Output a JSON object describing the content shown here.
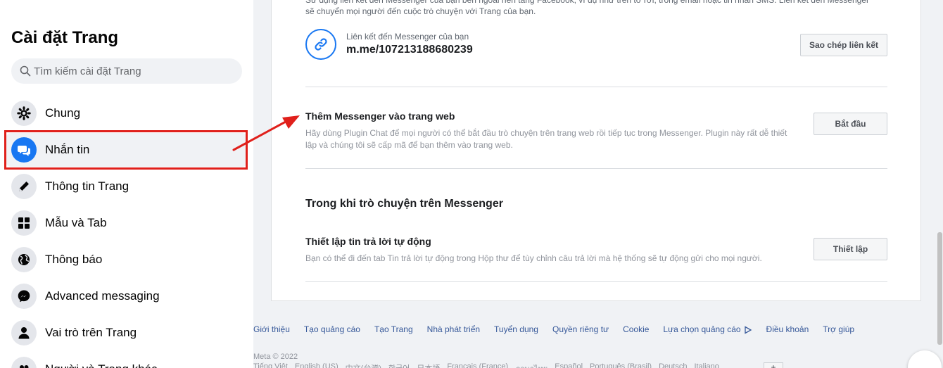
{
  "sidebar": {
    "title": "Cài đặt Trang",
    "search_placeholder": "Tìm kiếm cài đặt Trang",
    "items": [
      {
        "label": "Chung",
        "icon": "gear-icon"
      },
      {
        "label": "Nhắn tin",
        "icon": "chat-bubbles-icon",
        "active": true
      },
      {
        "label": "Thông tin Trang",
        "icon": "pencil-icon"
      },
      {
        "label": "Mẫu và Tab",
        "icon": "grid-icon"
      },
      {
        "label": "Thông báo",
        "icon": "globe-icon"
      },
      {
        "label": "Advanced messaging",
        "icon": "messenger-icon"
      },
      {
        "label": "Vai trò trên Trang",
        "icon": "person-icon"
      },
      {
        "label": "Người và Trang khác",
        "icon": "people-icon"
      }
    ]
  },
  "main": {
    "top_text_line1": "Sử dụng liên kết đến Messenger của bạn bên ngoài nền tảng Facebook, ví dụ như trên tờ rơi, trong email hoặc tin nhắn SMS. Liên kết đến Messenger",
    "top_text_line2": "sẽ chuyển mọi người đến cuộc trò chuyện với Trang của bạn.",
    "link_caption": "Liên kết đến Messenger của bạn",
    "link_value": "m.me/107213188680239",
    "copy_button": "Sao chép liên kết",
    "web_section": {
      "title": "Thêm Messenger vào trang web",
      "desc_line1": "Hãy dùng Plugin Chat để mọi người có thể bắt đầu trò chuyện trên trang web rồi tiếp tục trong Messenger. Plugin này rất dễ thiết",
      "desc_line2": "lập và chúng tôi sẽ cấp mã để bạn thêm vào trang web.",
      "button": "Bắt đầu"
    },
    "chat_heading": "Trong khi trò chuyện trên Messenger",
    "auto_reply": {
      "title": "Thiết lập tin trả lời tự động",
      "desc": "Bạn có thể đi đến tab Tin trả lời tự động trong Hộp thư để tùy chỉnh câu trả lời mà hệ thống sẽ tự động gửi cho mọi người.",
      "button": "Thiết lập"
    }
  },
  "footer": {
    "links": [
      "Giới thiệu",
      "Tạo quảng cáo",
      "Tạo Trang",
      "Nhà phát triển",
      "Tuyển dụng",
      "Quyền riêng tư",
      "Cookie",
      "Lựa chọn quảng cáo",
      "Điều khoản",
      "Trợ giúp"
    ],
    "copyright": "Meta © 2022",
    "languages": [
      "Tiếng Việt",
      "English (US)",
      "中文(台灣)",
      "한국어",
      "日本語",
      "Français (France)",
      "ภาษาไทย",
      "Español",
      "Português (Brasil)",
      "Deutsch",
      "Italiano"
    ],
    "plus": "+"
  },
  "colors": {
    "accent": "#1877f2",
    "highlight": "#e0201b"
  }
}
